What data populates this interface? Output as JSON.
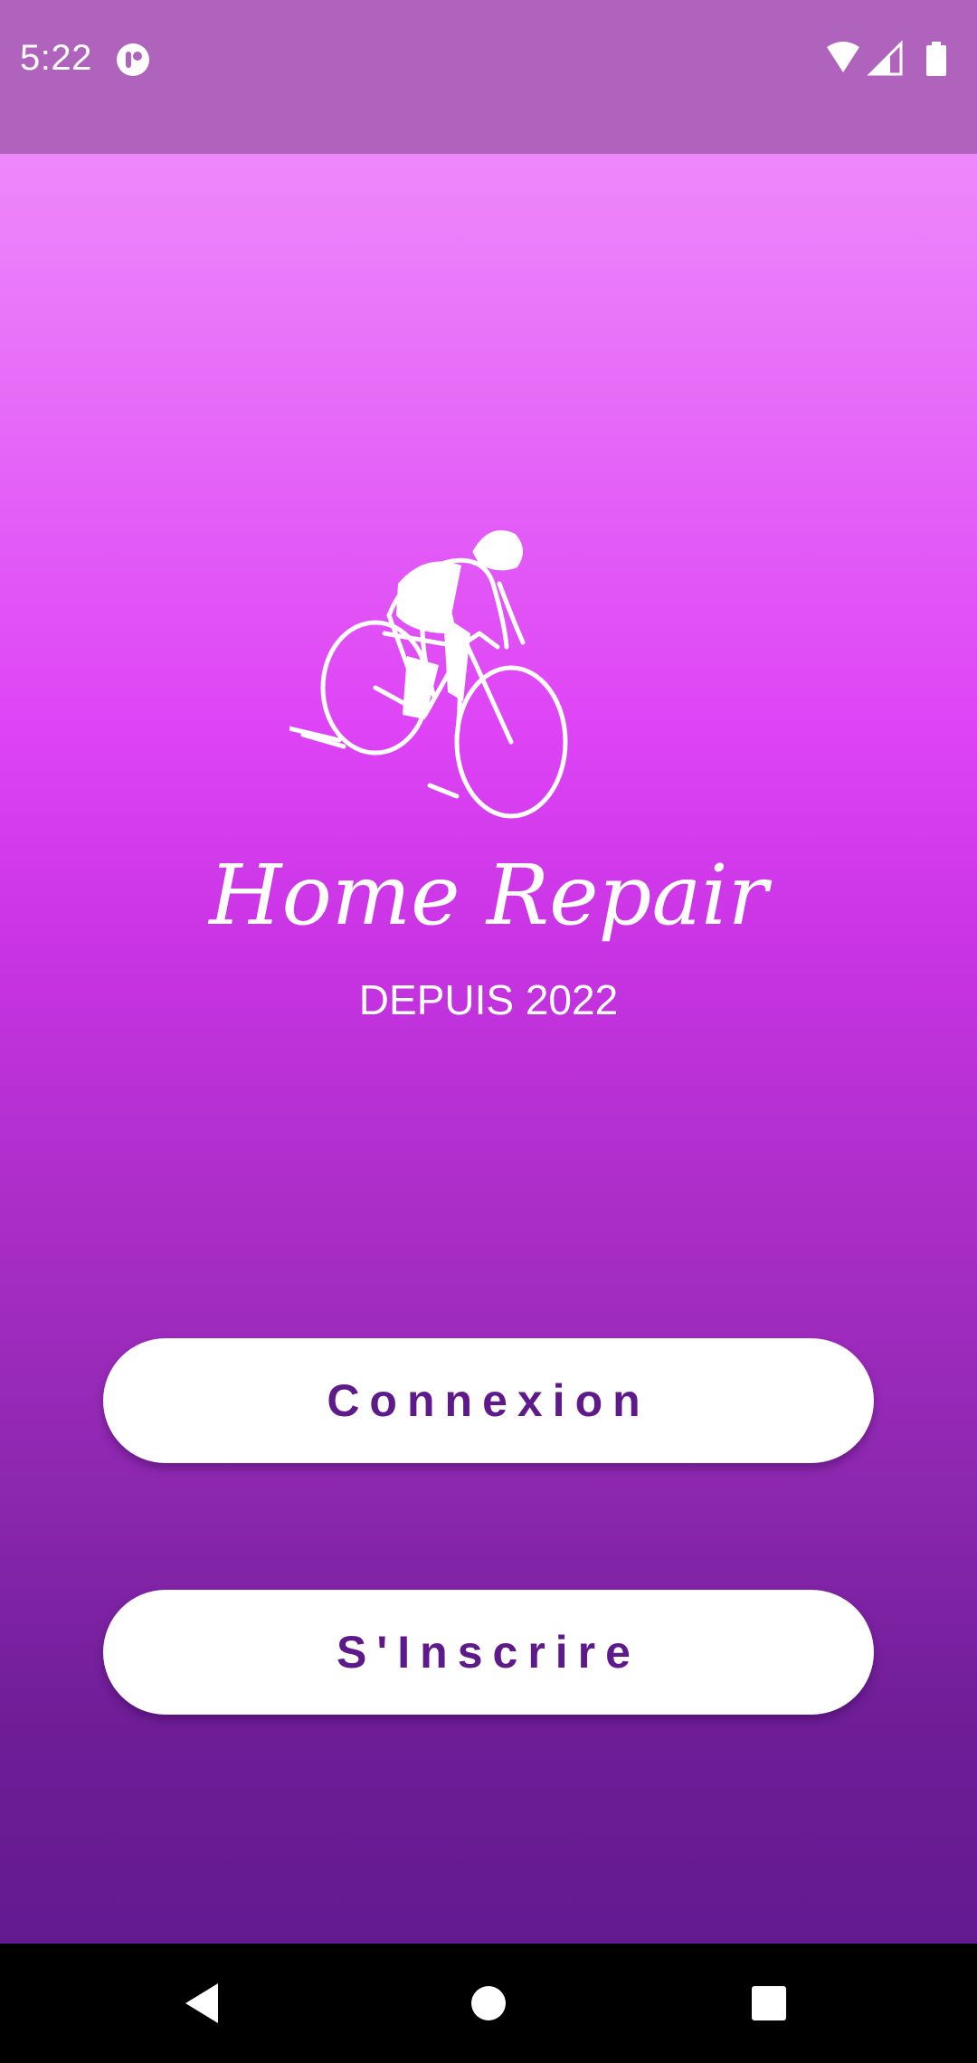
{
  "status_bar": {
    "time": "5:22",
    "app_icon": "notification-app-icon",
    "icons": [
      "wifi-icon",
      "cell-signal-icon",
      "battery-icon"
    ]
  },
  "logo": {
    "icon": "cyclist-icon"
  },
  "brand": {
    "title": "Home Repair",
    "subtitle": "DEPUIS 2022"
  },
  "buttons": {
    "login_label": "Connexion",
    "signup_label": "S'Inscrire"
  },
  "nav_bar": {
    "back": "back-icon",
    "home": "home-icon",
    "recents": "recents-icon"
  },
  "colors": {
    "status_bar": "#b063bd",
    "gradient_top": "#ee88fb",
    "gradient_mid": "#de44f6",
    "gradient_bottom": "#631a91",
    "button_bg": "#ffffff",
    "button_text": "#5e1a8a"
  }
}
